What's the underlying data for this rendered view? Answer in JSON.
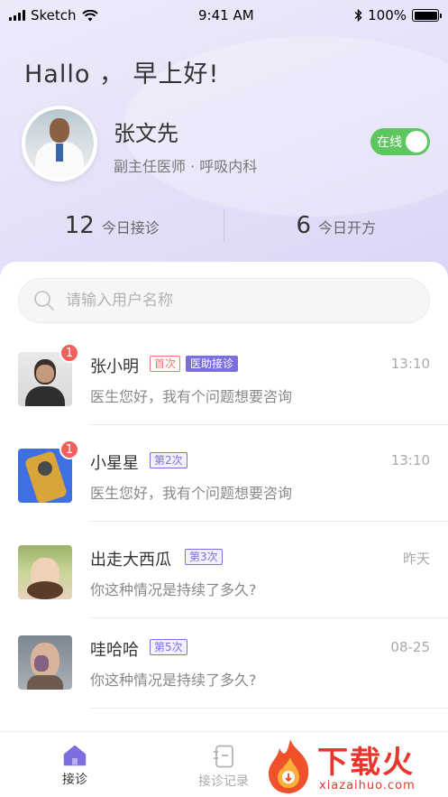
{
  "status_bar": {
    "carrier": "Sketch",
    "time": "9:41 AM",
    "battery": "100%"
  },
  "header": {
    "greeting": "Hallo ， 早上好!",
    "doctor_name": "张文先",
    "doctor_title": "副主任医师 · 呼吸内科",
    "online_label": "在线",
    "online": true
  },
  "stats": [
    {
      "value": "12",
      "label": "今日接诊"
    },
    {
      "value": "6",
      "label": "今日开方"
    }
  ],
  "search": {
    "placeholder": "请输入用户名称"
  },
  "conversations": [
    {
      "name": "张小明",
      "unread": "1",
      "tags": [
        {
          "text": "首次",
          "style": "first"
        },
        {
          "text": "医助接诊",
          "style": "assist"
        }
      ],
      "time": "13:10",
      "message": "医生您好，我有个问题想要咨询"
    },
    {
      "name": "小星星",
      "unread": "1",
      "tags": [
        {
          "text": "第2次",
          "style": "visit"
        }
      ],
      "time": "13:10",
      "message": "医生您好，我有个问题想要咨询"
    },
    {
      "name": "出走大西瓜",
      "unread": "",
      "tags": [
        {
          "text": "第3次",
          "style": "visit"
        }
      ],
      "time": "昨天",
      "message": "你这种情况是持续了多久?"
    },
    {
      "name": "哇哈哈",
      "unread": "",
      "tags": [
        {
          "text": "第5次",
          "style": "visit"
        }
      ],
      "time": "08-25",
      "message": "你这种情况是持续了多久?"
    }
  ],
  "tabbar": [
    {
      "label": "接诊",
      "icon": "home-icon",
      "active": true
    },
    {
      "label": "接诊记录",
      "icon": "record-icon",
      "active": false
    }
  ],
  "watermark": {
    "text": "下载火",
    "url": "xiazaihuo.com"
  },
  "colors": {
    "accent": "#7b6fe0",
    "online": "#5ec65f",
    "badge": "#f25f5c",
    "first_tag": "#f0766b"
  }
}
